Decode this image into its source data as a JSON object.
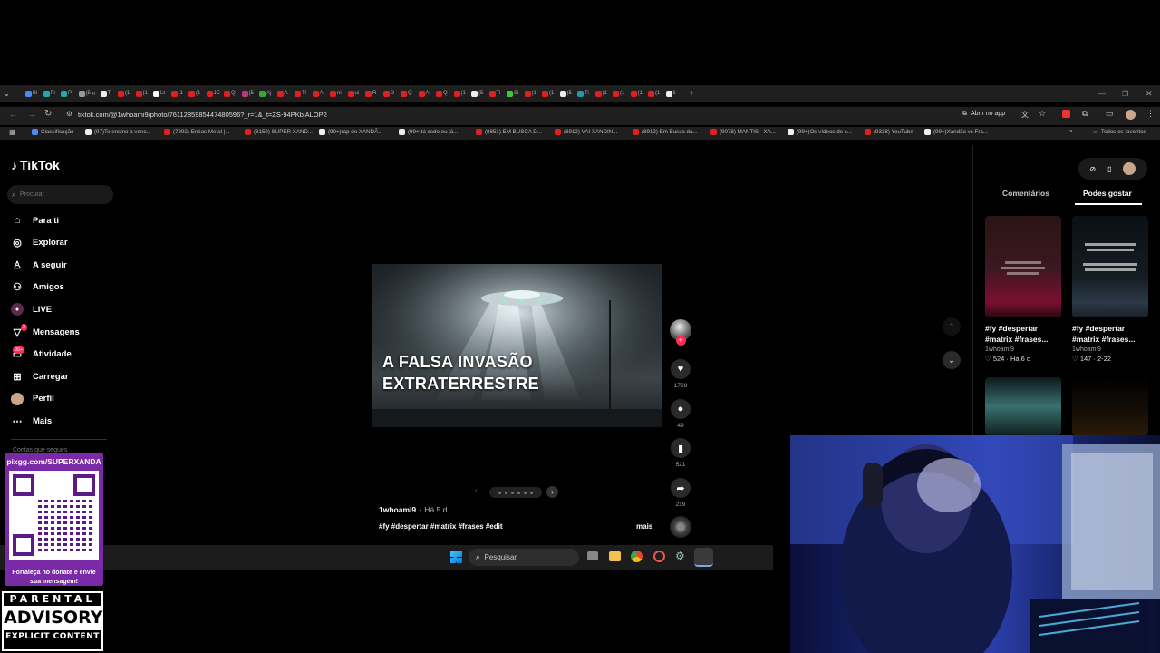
{
  "browser": {
    "tabs": [
      "Bi",
      "Pi",
      "Pi",
      "(5",
      "Ti",
      "(1",
      "(1",
      "Lt",
      "(1",
      "(1",
      "JC",
      "Q",
      "(5",
      "Aj",
      "A",
      "Ti",
      "A",
      "ni",
      "ui",
      "R",
      "O",
      "Q",
      "A",
      "Q",
      "(1",
      "(5",
      "Ti",
      "Si",
      "(1",
      "(1",
      "(5",
      "Ti",
      "(1",
      "(1",
      "(1",
      "(1",
      "Ii"
    ],
    "url": "tiktok.com/@1whoami9/photo/7611285985447480596?_r=1&_t=ZS-94PKbjALOP2",
    "open_in_app": "Abrir no app",
    "bookmarks": [
      "Classificação",
      "(97)Te ensino a venc...",
      "(7292) Enéas Metal |...",
      "(8159) SUPER XAND...",
      "(99+)rap do XANDÃ...",
      "(99+)tá cedo ou já...",
      "(8851) EM BUSCA D...",
      "(8912) VAI XANDIN...",
      "(8912) Em Busca da...",
      "(9078) MANTIS - XA...",
      "(99+)Os vídeos de c...",
      "(9338) YouTube",
      "(99+)Xandão vs Fra..."
    ],
    "all_favorites": "Todos os favoritos"
  },
  "tiktok": {
    "logo": "TikTok",
    "search_placeholder": "Procurar",
    "nav": [
      {
        "label": "Para ti",
        "icon": "home-icon"
      },
      {
        "label": "Explorar",
        "icon": "compass-icon"
      },
      {
        "label": "A seguir",
        "icon": "following-icon"
      },
      {
        "label": "Amigos",
        "icon": "friends-icon"
      },
      {
        "label": "LIVE",
        "icon": "live-icon"
      },
      {
        "label": "Mensagens",
        "icon": "messages-icon"
      },
      {
        "label": "Atividade",
        "icon": "activity-icon"
      },
      {
        "label": "Carregar",
        "icon": "upload-icon"
      },
      {
        "label": "Perfil",
        "icon": "profile-icon"
      },
      {
        "label": "Mais",
        "icon": "more-icon"
      }
    ],
    "nav_badges": {
      "mensagens": "2",
      "atividade": "99+"
    },
    "hidden_section_label": "Contas que segues",
    "post": {
      "title_line1": "A FALSA INVASÃO",
      "title_line2": "EXTRATERRESTRE",
      "author": "1whoami9",
      "time": "· Há 5 d",
      "caption": "#fy #despertar #matrix #frases #edit",
      "more": "mais",
      "likes": "1728",
      "comments": "49",
      "saves": "521",
      "shares": "219"
    },
    "right_tabs": [
      "Comentários",
      "Podes gostar"
    ],
    "recommendations": [
      {
        "title_line1": "#fy #despertar",
        "title_line2": "#matrix #frases...",
        "author": "1whoami9",
        "likes": "524",
        "date": "Há 6 d"
      },
      {
        "title_line1": "#fy #despertar",
        "title_line2": "#matrix #frases...",
        "author": "1whoami9",
        "likes": "147",
        "date": "2-22"
      }
    ]
  },
  "taskbar": {
    "search": "Pesquisar"
  },
  "overlay": {
    "qr_url": "pixgg.com/SUPERXANDA",
    "qr_caption": "Fortaleça no donate e envie sua mensagem!",
    "advisory_top": "PARENTAL",
    "advisory_mid": "ADVISORY",
    "advisory_bottom": "EXPLICIT CONTENT"
  }
}
